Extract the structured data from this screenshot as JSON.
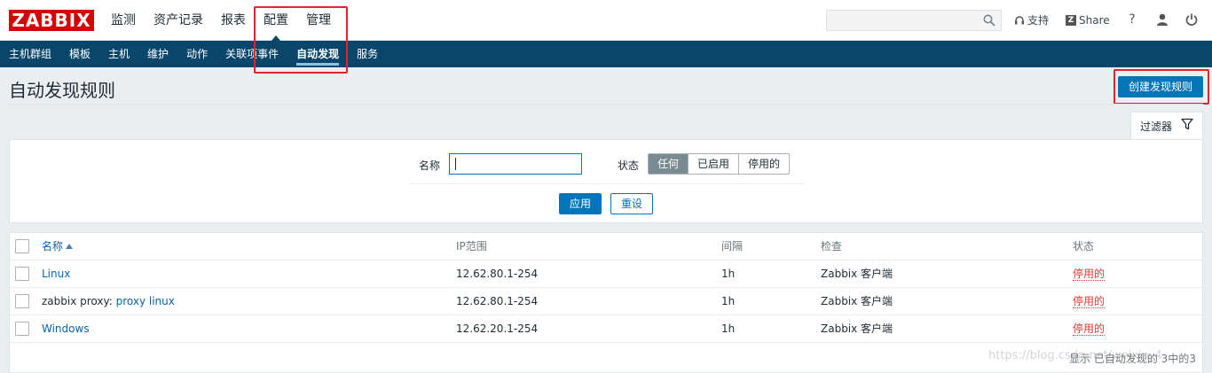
{
  "header": {
    "logo": "ZABBIX",
    "menu": [
      "监测",
      "资产记录",
      "报表",
      "配置",
      "管理"
    ],
    "active_menu_index": 3,
    "search_placeholder": "",
    "support_label": "支持",
    "share_badge": "Z",
    "share_label": "Share",
    "help_icon": "?",
    "icons": [
      "search-icon",
      "headset-icon",
      "question-icon",
      "user-icon",
      "power-icon"
    ]
  },
  "subnav": {
    "items": [
      "主机群组",
      "模板",
      "主机",
      "维护",
      "动作",
      "关联项事件",
      "自动发现",
      "服务"
    ],
    "selected_index": 6
  },
  "page": {
    "title": "自动发现规则",
    "create_button": "创建发现规则"
  },
  "filter": {
    "tab_label": "过滤器",
    "name_label": "名称",
    "name_value": "",
    "status_label": "状态",
    "status_options": [
      "任何",
      "已启用",
      "停用的"
    ],
    "status_selected_index": 0,
    "apply_label": "应用",
    "reset_label": "重设"
  },
  "table": {
    "columns": [
      "名称",
      "IP范围",
      "间隔",
      "检查",
      "状态"
    ],
    "rows": [
      {
        "prefix": "",
        "name": "Linux",
        "ip_range": "12.62.80.1-254",
        "interval": "1h",
        "checks": "Zabbix 客户端",
        "status": "停用的"
      },
      {
        "prefix": "zabbix proxy: ",
        "name": "proxy linux",
        "ip_range": "12.62.80.1-254",
        "interval": "1h",
        "checks": "Zabbix 客户端",
        "status": "停用的"
      },
      {
        "prefix": "",
        "name": "Windows",
        "ip_range": "12.62.20.1-254",
        "interval": "1h",
        "checks": "Zabbix 客户端",
        "status": "停用的"
      }
    ],
    "footer": "显示 已自动发现的 3中的3"
  },
  "watermark": "https://blog.csdn.net/weixin_4",
  "colors": {
    "brand_red": "#d40000",
    "nav_blue": "#0a466a",
    "primary_blue": "#0275b8",
    "link_blue": "#0a63a8",
    "disabled_red": "#e33734",
    "annotation_red": "#e0242a"
  }
}
